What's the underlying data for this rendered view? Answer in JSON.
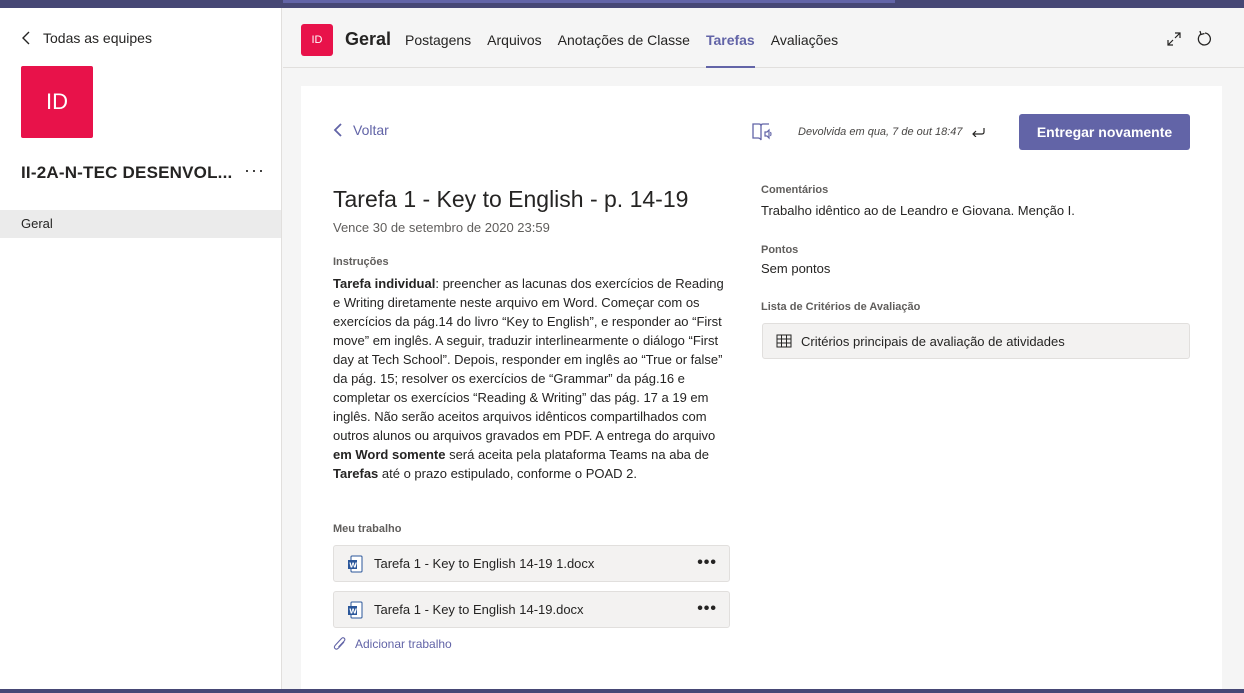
{
  "sidebar": {
    "back_label": "Todas as equipes",
    "team_initials": "ID",
    "team_name": "II-2A-N-TEC DESENVOL...",
    "more_label": "···",
    "channel_label": "Geral"
  },
  "header": {
    "channel_initials": "ID",
    "channel_title": "Geral",
    "tabs": [
      {
        "label": "Postagens"
      },
      {
        "label": "Arquivos"
      },
      {
        "label": "Anotações de Classe"
      },
      {
        "label": "Tarefas",
        "active": true
      },
      {
        "label": "Avaliações"
      }
    ]
  },
  "assignment": {
    "back_label": "Voltar",
    "returned_text": "Devolvida em qua, 7 de out 18:47",
    "resubmit_label": "Entregar novamente",
    "title": "Tarefa 1 - Key to English - p. 14-19",
    "due": "Vence 30 de setembro de 2020 23:59",
    "instructions_label": "Instruções",
    "instructions": {
      "bold_intro": "Tarefa individual",
      "part1": ": preencher as lacunas dos exercícios de Reading e Writing diretamente neste arquivo em Word. Começar com os exercícios da pág.14 do livro “Key to English”, e responder ao “First move” em inglês.  A seguir, traduzir interlinearmente o diálogo “First day at Tech School”. Depois, responder em inglês ao “True or false” da pág. 15; resolver os exercícios de “Grammar” da pág.16 e completar os exercícios “Reading & Writing” das pág. 17 a 19 em inglês. Não serão aceitos arquivos idênticos compartilhados com outros alunos ou arquivos gravados em PDF. A entrega do arquivo ",
      "bold_2": "em Word somente",
      "part2": " será aceita pela plataforma Teams na aba de ",
      "bold_3": "Tarefas",
      "part3": " até o prazo estipulado, conforme o POAD 2."
    },
    "my_work_label": "Meu trabalho",
    "files": [
      {
        "name": "Tarefa 1 - Key to English 14-19 1.docx",
        "more": "•••"
      },
      {
        "name": "Tarefa 1 - Key to English 14-19.docx",
        "more": "•••"
      }
    ],
    "add_work_label": "Adicionar trabalho",
    "comments_label": "Comentários",
    "comments_value": "Trabalho idêntico ao de Leandro e Giovana. Menção I.",
    "points_label": "Pontos",
    "points_value": "Sem pontos",
    "rubric_list_label": "Lista de Critérios de Avaliação",
    "rubric_name": "Critérios principais de avaliação de atividades"
  },
  "colors": {
    "accent": "#6264a7",
    "team_avatar": "#e8124a",
    "topbar": "#464775"
  },
  "icons": [
    "chevron-left-icon",
    "expand-icon",
    "refresh-icon",
    "immersive-reader-icon",
    "return-arrow-icon",
    "word-file-icon",
    "paperclip-icon",
    "grid-rubric-icon"
  ]
}
